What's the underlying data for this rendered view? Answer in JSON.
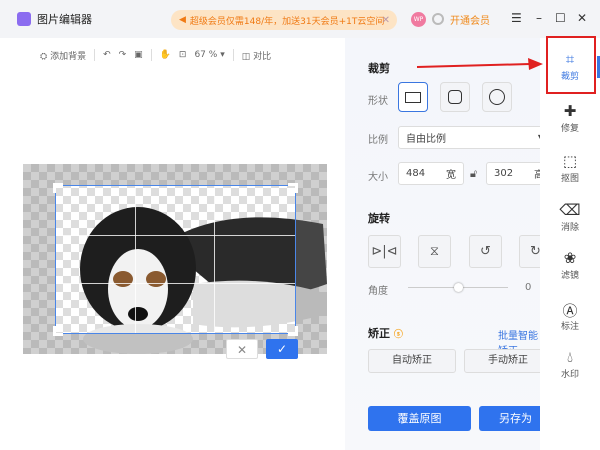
{
  "app": {
    "title": "图片编辑器",
    "promo": "超级会员仅需148/年，加送31天会员+1T云空间",
    "avatar": "WP",
    "vip": "开通会员"
  },
  "toolbar": {
    "add_bg": "添加背景",
    "zoom": "67 %",
    "compare": "对比"
  },
  "crop": {
    "title": "裁剪",
    "shape_label": "形状",
    "ratio_label": "比例",
    "ratio_value": "自由比例",
    "size_label": "大小",
    "width": "484",
    "width_unit": "宽",
    "height": "302",
    "height_unit": "高"
  },
  "rotate": {
    "title": "旋转",
    "angle_label": "角度",
    "angle_value": "0",
    "angle_unit": "°",
    "angle_fraction": 0.5
  },
  "correct": {
    "title": "矫正",
    "batch": "批量智能矫正",
    "auto": "自动矫正",
    "manual": "手动矫正"
  },
  "actions": {
    "overwrite": "覆盖原图",
    "save_as": "另存为"
  },
  "sidebar": {
    "items": [
      {
        "label": "裁剪",
        "icon": "crop-icon"
      },
      {
        "label": "修复",
        "icon": "bandage-icon"
      },
      {
        "label": "抠图",
        "icon": "cutout-icon"
      },
      {
        "label": "消除",
        "icon": "eraser-icon"
      },
      {
        "label": "滤镜",
        "icon": "filter-icon"
      },
      {
        "label": "标注",
        "icon": "annotate-icon"
      },
      {
        "label": "水印",
        "icon": "watermark-icon"
      }
    ]
  },
  "colors": {
    "accent": "#2f73ee",
    "highlight": "#e02020"
  }
}
